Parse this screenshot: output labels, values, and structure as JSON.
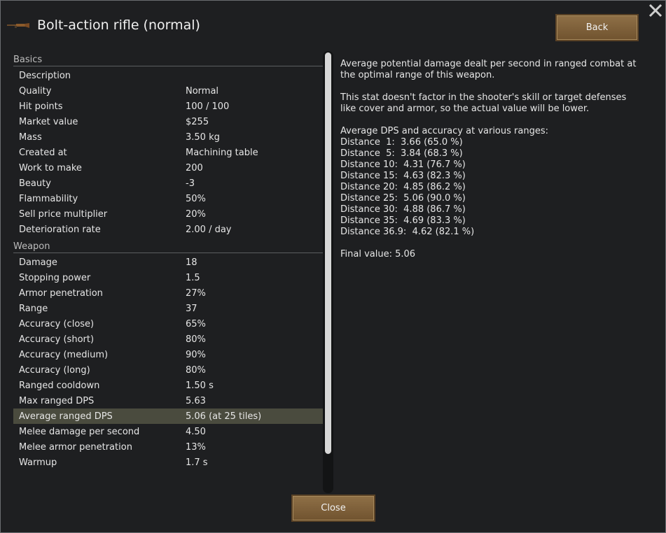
{
  "window": {
    "title": "Bolt-action rifle (normal)",
    "back_label": "Back",
    "close_label": "Close"
  },
  "sections": [
    {
      "header": "Basics",
      "rows": [
        {
          "label": "Description",
          "value": ""
        },
        {
          "label": "Quality",
          "value": "Normal"
        },
        {
          "label": "Hit points",
          "value": "100 / 100"
        },
        {
          "label": "Market value",
          "value": "$255"
        },
        {
          "label": "Mass",
          "value": "3.50 kg"
        },
        {
          "label": "Created at",
          "value": "Machining table"
        },
        {
          "label": "Work to make",
          "value": "200"
        },
        {
          "label": "Beauty",
          "value": "-3"
        },
        {
          "label": "Flammability",
          "value": "50%"
        },
        {
          "label": "Sell price multiplier",
          "value": "20%"
        },
        {
          "label": "Deterioration rate",
          "value": "2.00 / day"
        }
      ]
    },
    {
      "header": "Weapon",
      "rows": [
        {
          "label": "Damage",
          "value": "18"
        },
        {
          "label": "Stopping power",
          "value": "1.5"
        },
        {
          "label": "Armor penetration",
          "value": "27%"
        },
        {
          "label": "Range",
          "value": "37"
        },
        {
          "label": "Accuracy (close)",
          "value": "65%"
        },
        {
          "label": "Accuracy (short)",
          "value": "80%"
        },
        {
          "label": "Accuracy (medium)",
          "value": "90%"
        },
        {
          "label": "Accuracy (long)",
          "value": "80%"
        },
        {
          "label": "Ranged cooldown",
          "value": "1.50 s"
        },
        {
          "label": "Max ranged DPS",
          "value": "5.63"
        },
        {
          "label": "Average ranged DPS",
          "value": "5.06 (at 25 tiles)",
          "selected": true
        },
        {
          "label": "Melee damage per second",
          "value": "4.50"
        },
        {
          "label": "Melee armor penetration",
          "value": "13%"
        },
        {
          "label": "Warmup",
          "value": "1.7 s"
        }
      ]
    }
  ],
  "description": {
    "para1": "Average potential damage dealt per second in ranged combat at the optimal range of this weapon.",
    "para2": "This stat doesn't factor in the shooter's skill or target defenses like cover and armor, so the actual value will be lower.",
    "ranges_header": "Average DPS and accuracy at various ranges:",
    "ranges": [
      "Distance  1:  3.66 (65.0 %)",
      "Distance  5:  3.84 (68.3 %)",
      "Distance 10:  4.31 (76.7 %)",
      "Distance 15:  4.63 (82.3 %)",
      "Distance 20:  4.85 (86.2 %)",
      "Distance 25:  5.06 (90.0 %)",
      "Distance 30:  4.88 (86.7 %)",
      "Distance 35:  4.69 (83.3 %)",
      "Distance 36.9:  4.62 (82.1 %)"
    ],
    "final_value": "Final value: 5.06"
  },
  "icons": {
    "rifle": "rifle-icon",
    "close": "close-icon"
  }
}
